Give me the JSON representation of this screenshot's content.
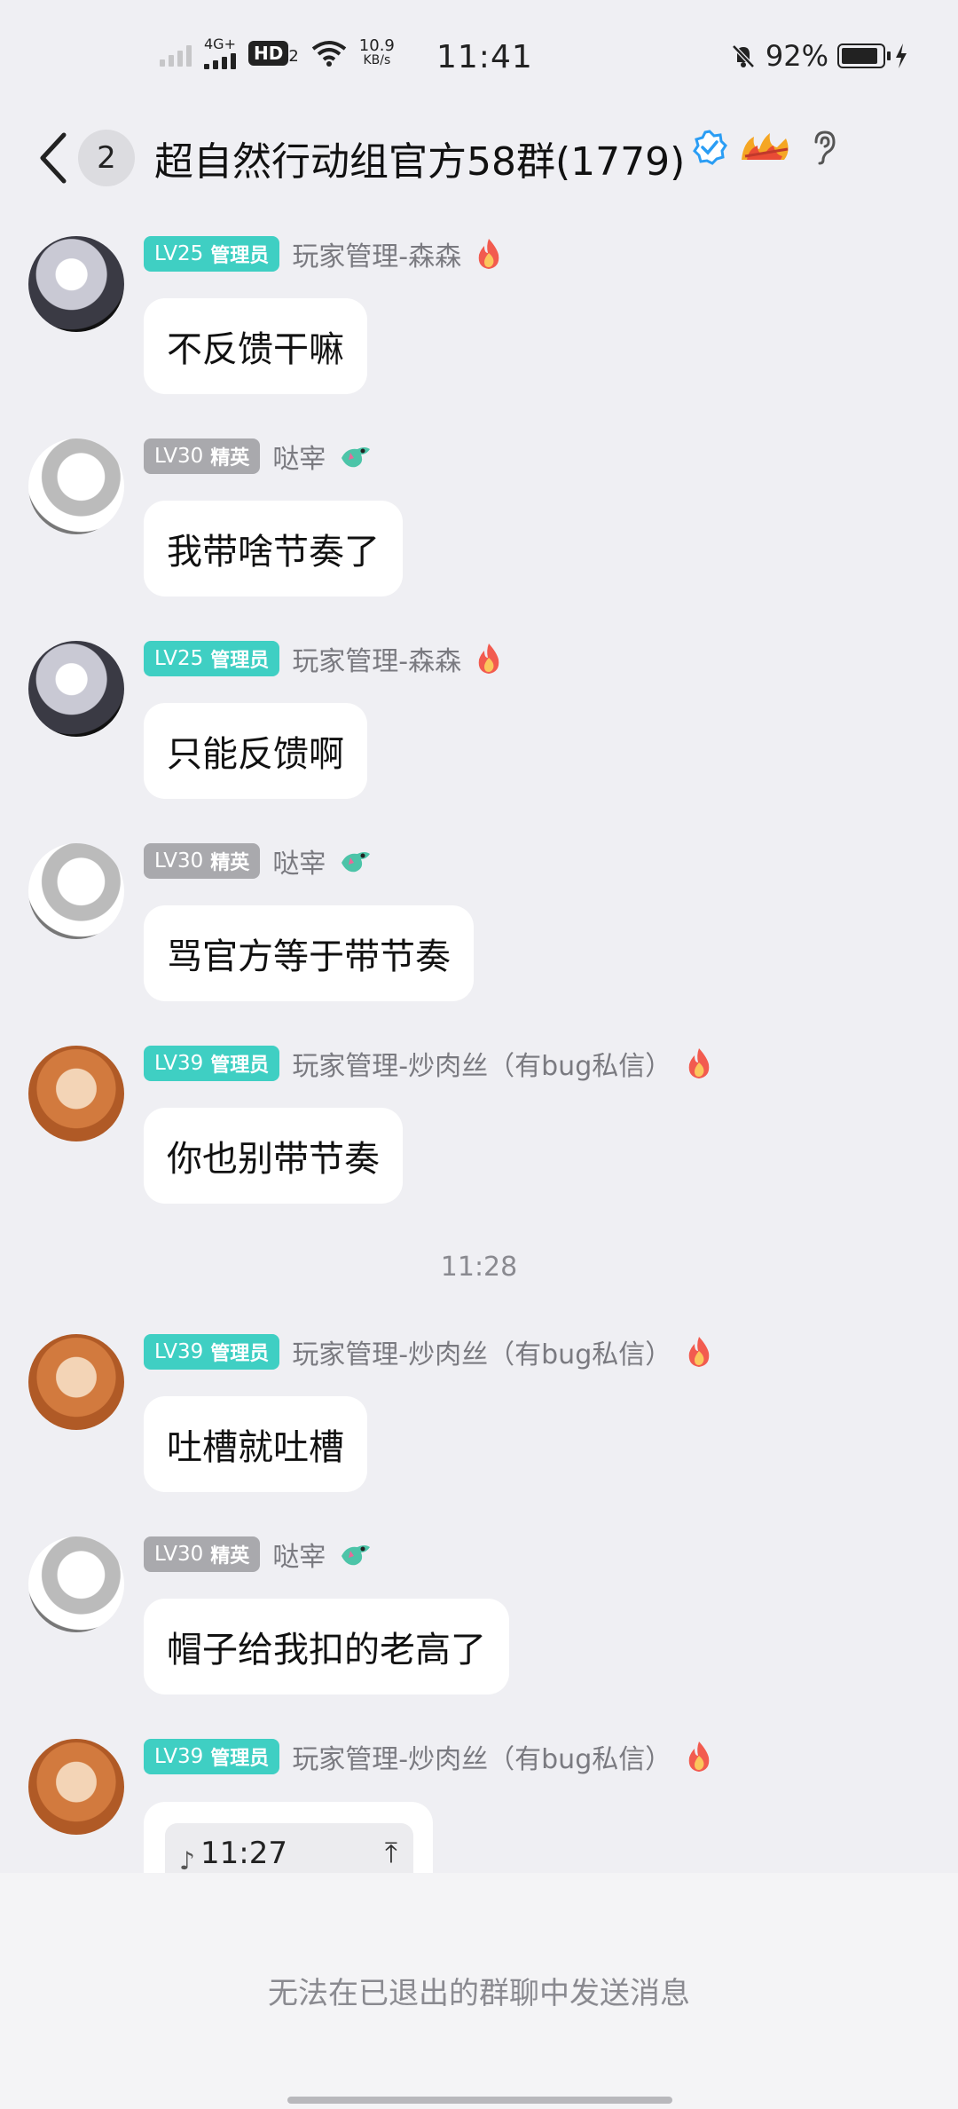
{
  "status_bar": {
    "network": "4G+",
    "hd": "HD",
    "hd_sub": "2",
    "speed_value": "10.9",
    "speed_unit": "KB/s",
    "time": "11:41",
    "battery": "92%"
  },
  "header": {
    "back_count": "2",
    "title": "超自然行动组官方58群(1779)"
  },
  "messages": [
    {
      "level": "LV25",
      "role": "管理员",
      "sender": "玩家管理-森森",
      "text": "不反馈干嘛"
    },
    {
      "level": "LV30",
      "role": "精英",
      "sender": "哒宰",
      "text": "我带啥节奏了"
    },
    {
      "level": "LV25",
      "role": "管理员",
      "sender": "玩家管理-森森",
      "text": "只能反馈啊"
    },
    {
      "level": "LV30",
      "role": "精英",
      "sender": "哒宰",
      "text": "骂官方等于带节奏"
    },
    {
      "level": "LV39",
      "role": "管理员",
      "sender": "玩家管理-炒肉丝（有bug私信）",
      "text": "你也别带节奏"
    },
    {
      "level": "LV39",
      "role": "管理员",
      "sender": "玩家管理-炒肉丝（有bug私信）",
      "text": "吐槽就吐槽"
    },
    {
      "level": "LV30",
      "role": "精英",
      "sender": "哒宰",
      "text": "帽子给我扣的老高了"
    },
    {
      "level": "LV39",
      "role": "管理员",
      "sender": "玩家管理-炒肉丝（有bug私信）",
      "voice_time": "11:27"
    }
  ],
  "timestamp": "11:28",
  "bottom_notice": "无法在已退出的群聊中发送消息"
}
